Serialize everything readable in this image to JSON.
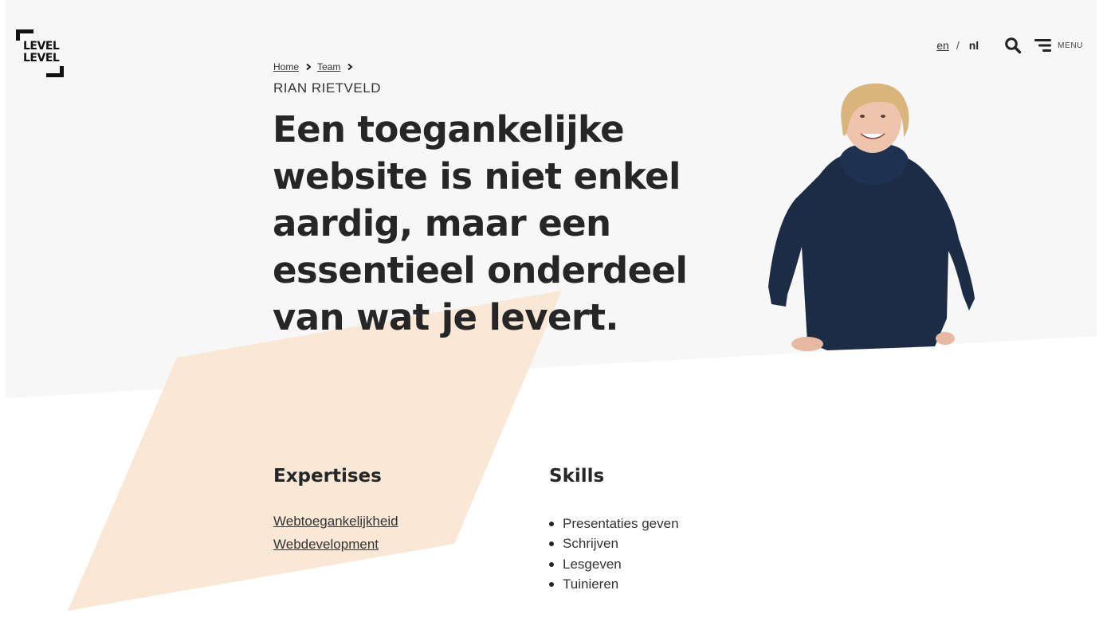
{
  "colors": {
    "hero_background": "#f7f7f7",
    "accent_shape": "#f9e6d3",
    "text": "#262626",
    "sweater": "#1c2c45"
  },
  "logo": {
    "line1": "LEVEL",
    "line2": "LEVEL"
  },
  "header": {
    "languages": [
      {
        "code": "en",
        "label": "en",
        "active": false
      },
      {
        "code": "nl",
        "label": "nl",
        "active": true
      }
    ],
    "lang_separator": "/",
    "search_icon": "search-icon",
    "menu_icon": "menu-icon",
    "menu_label": "MENU"
  },
  "breadcrumb": {
    "items": [
      {
        "label": "Home"
      },
      {
        "label": "Team"
      }
    ]
  },
  "profile": {
    "name": "RIAN RIETVELD",
    "quote": "Een toegankelijke website is niet enkel aardig, maar een essentieel onderdeel van wat je levert.",
    "photo_alt": "Portrait of Rian Rietveld"
  },
  "expertises": {
    "heading": "Expertises",
    "items": [
      "Webtoegankelijkheid",
      "Webdevelopment"
    ]
  },
  "skills": {
    "heading": "Skills",
    "items": [
      "Presentaties geven",
      "Schrijven",
      "Lesgeven",
      "Tuinieren"
    ]
  }
}
